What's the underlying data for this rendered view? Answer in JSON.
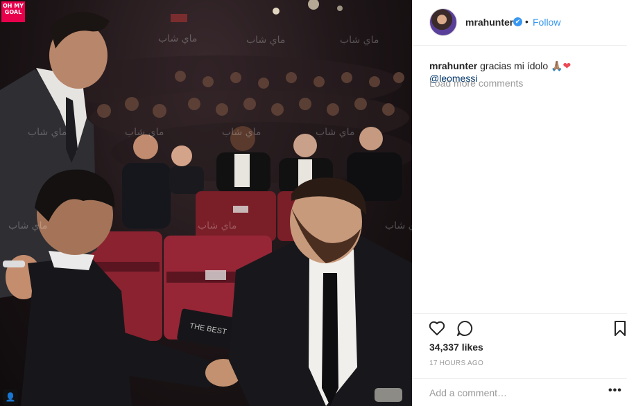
{
  "photo": {
    "badge_text": "OH MY GOAL",
    "trophy_card_text": "THE BEST",
    "watermark_text": "ماي شاب"
  },
  "header": {
    "username": "mrahunter",
    "verified_mark": "✔",
    "separator": "•",
    "follow_label": "Follow"
  },
  "caption": {
    "username": "mrahunter",
    "text": "gracias mi ídolo",
    "hands_emoji": "🙏🏽",
    "heart_emoji": "❤",
    "mention": "@leomessi"
  },
  "comments": {
    "load_more_label": "Load more comments"
  },
  "actions": {
    "like_icon": "heart-outline-icon",
    "comment_icon": "speech-bubble-icon",
    "save_icon": "bookmark-icon"
  },
  "stats": {
    "likes": "34,337 likes",
    "time_ago": "17 HOURS AGO"
  },
  "comment_box": {
    "placeholder": "Add a comment…",
    "more_label": "•••"
  },
  "colors": {
    "accent": "#3897f0",
    "heart": "#ed4956",
    "muted": "#999999",
    "badge": "#e8004c"
  }
}
